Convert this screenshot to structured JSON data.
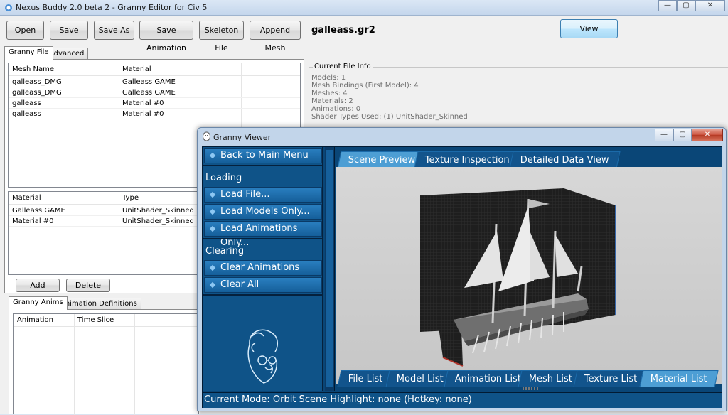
{
  "main": {
    "title": "Nexus Buddy 2.0 beta 2 - Granny Editor for Civ 5",
    "controls": {
      "minimize": "—",
      "maximize": "▢",
      "close": "✕"
    },
    "toolbar": {
      "open": "Open",
      "save": "Save",
      "save_as": "Save As",
      "save_animation": "Save Animation",
      "skeleton_file": "Skeleton File",
      "append_mesh": "Append Mesh",
      "view": "View"
    },
    "filename": "galleass.gr2",
    "top_tabs": [
      "Granny File",
      "Advanced"
    ],
    "mesh_list": {
      "headers": [
        "Mesh Name",
        "Material"
      ],
      "rows": [
        [
          "galleass_DMG",
          "Galleass GAME"
        ],
        [
          "galleass_DMG",
          "Galleass GAME"
        ],
        [
          "galleass",
          "Material #0"
        ],
        [
          "galleass",
          "Material #0"
        ]
      ]
    },
    "material_list": {
      "headers": [
        "Material",
        "Type"
      ],
      "rows": [
        [
          "Galleass GAME",
          "UnitShader_Skinned"
        ],
        [
          "Material #0",
          "UnitShader_Skinned"
        ]
      ]
    },
    "add": "Add",
    "delete": "Delete",
    "anim_tabs": [
      "Granny Anims",
      "Animation Definitions"
    ],
    "anim_list": {
      "headers": [
        "Animation",
        "Time Slice"
      ]
    },
    "file_info": {
      "title": "Current File Info",
      "lines": [
        "Models: 1",
        "Mesh Bindings (First Model): 4",
        "Meshes: 4",
        "Materials: 2",
        "Animations: 0",
        "Shader Types Used: (1) UnitShader_Skinned"
      ]
    }
  },
  "viewer": {
    "title": "Granny Viewer",
    "back": "Back to Main Menu",
    "loading_header": "Loading",
    "load_file": "Load File...",
    "load_models": "Load Models Only...",
    "load_anims": "Load Animations Only...",
    "clearing_header": "Clearing",
    "clear_anims": "Clear Animations",
    "clear_all": "Clear All",
    "top_tabs": [
      "Scene Preview",
      "Texture Inspection",
      "Detailed Data View"
    ],
    "bottom_tabs": [
      "File List",
      "Model List",
      "Animation List",
      "Mesh List",
      "Texture List",
      "Material List"
    ],
    "status": "Current Mode: Orbit Scene   Highlight: none (Hotkey: none)"
  },
  "colors": {
    "viewer_bg": "#0a4677",
    "tab_active": "#4d9ed4",
    "button_blue": "#2a7fc0"
  }
}
